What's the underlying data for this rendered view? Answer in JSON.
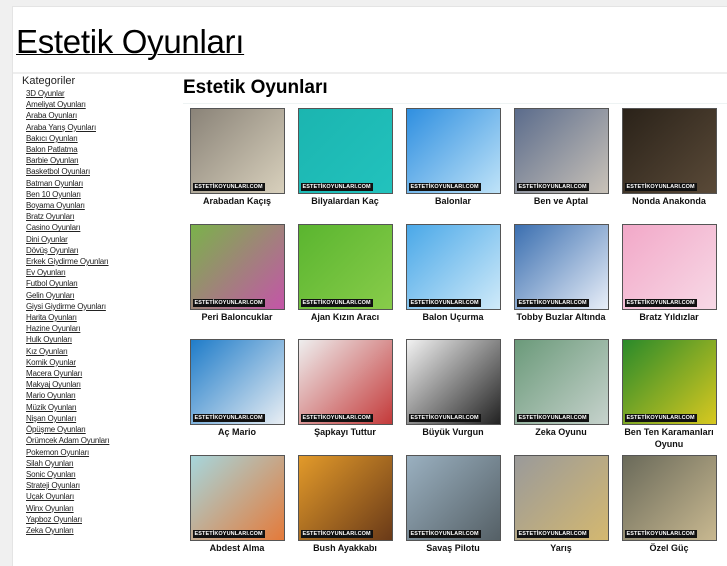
{
  "site_title": "Estetik Oyunları",
  "sidebar": {
    "heading": "Kategoriler",
    "items": [
      "3D Oyunlar",
      "Ameliyat Oyunları",
      "Araba Oyunları",
      "Araba Yarış Oyunları",
      "Bakıcı Oyunları",
      "Balon Patlatma",
      "Barbie Oyunları",
      "Basketbol Oyunları",
      "Batman Oyunları",
      "Ben 10 Oyunları",
      "Boyama Oyunları",
      "Bratz Oyunları",
      "Casino Oyunları",
      "Dini Oyunlar",
      "Dövüş Oyunları",
      "Erkek Giydirme Oyunları",
      "Ev Oyunları",
      "Futbol Oyunları",
      "Gelin Oyunları",
      "Giysi Giydirme Oyunları",
      "Harita Oyunları",
      "Hazine Oyunları",
      "Hulk Oyunları",
      "Kız Oyunları",
      "Komik Oyunlar",
      "Macera Oyunları",
      "Makyaj Oyunları",
      "Mario Oyunları",
      "Müzik Oyunları",
      "Nişan Oyunları",
      "Öpüşme Oyunları",
      "Örümcek Adam Oyunları",
      "Pokemon Oyunları",
      "Silah Oyunları",
      "Sonic Oyunları",
      "Strateji Oyunları",
      "Uçak Oyunları",
      "Winx Oyunları",
      "Yapboz Oyunları",
      "Zeka Oyunları"
    ]
  },
  "main": {
    "title": "Estetik Oyunları",
    "watermark": "ESTETİKOYUNLARI.COM",
    "games": [
      {
        "title": "Arabadan Kaçış",
        "colors": [
          "#8a8378",
          "#d8d0bc"
        ]
      },
      {
        "title": "Bilyalardan Kaç",
        "colors": [
          "#1bb5b0",
          "#22c2bd"
        ]
      },
      {
        "title": "Balonlar",
        "colors": [
          "#2f8fe0",
          "#bfe3f8"
        ]
      },
      {
        "title": "Ben ve Aptal",
        "colors": [
          "#5b6c8c",
          "#c9c2b8"
        ]
      },
      {
        "title": "Nonda Anakonda",
        "colors": [
          "#2a2219",
          "#5a4a38"
        ]
      },
      {
        "title": "Peri Baloncuklar",
        "colors": [
          "#7ab24a",
          "#c455a8"
        ]
      },
      {
        "title": "Ajan Kızın Aracı",
        "colors": [
          "#5ab52f",
          "#88cc4a"
        ]
      },
      {
        "title": "Balon Uçurma",
        "colors": [
          "#4aa8e8",
          "#cfeaf9"
        ]
      },
      {
        "title": "Tobby Buzlar Altında",
        "colors": [
          "#3b6fb0",
          "#e8eef8"
        ]
      },
      {
        "title": "Bratz Yıldızlar",
        "colors": [
          "#f2a8c8",
          "#f7d9e6"
        ]
      },
      {
        "title": "Aç Mario",
        "colors": [
          "#1f7cc9",
          "#e9eef3"
        ]
      },
      {
        "title": "Şapkayı Tuttur",
        "colors": [
          "#eeeeee",
          "#c43a3a"
        ]
      },
      {
        "title": "Büyük Vurgun",
        "colors": [
          "#f2f2f2",
          "#222222"
        ]
      },
      {
        "title": "Zeka Oyunu",
        "colors": [
          "#6b9a7a",
          "#c6d2cc"
        ]
      },
      {
        "title": "Ben Ten Karamanları Oyunu",
        "colors": [
          "#2a8a2a",
          "#d8c820"
        ]
      },
      {
        "title": "Abdest Alma",
        "colors": [
          "#a6d6dc",
          "#e47a3a"
        ]
      },
      {
        "title": "Bush Ayakkabı",
        "colors": [
          "#e29a2a",
          "#6a3a18"
        ]
      },
      {
        "title": "Savaş Pilotu",
        "colors": [
          "#9ab0c0",
          "#556066"
        ]
      },
      {
        "title": "Yarış",
        "colors": [
          "#9a9a9a",
          "#d4b870"
        ]
      },
      {
        "title": "Özel Güç",
        "colors": [
          "#6a6a5a",
          "#c8b890"
        ]
      }
    ]
  }
}
